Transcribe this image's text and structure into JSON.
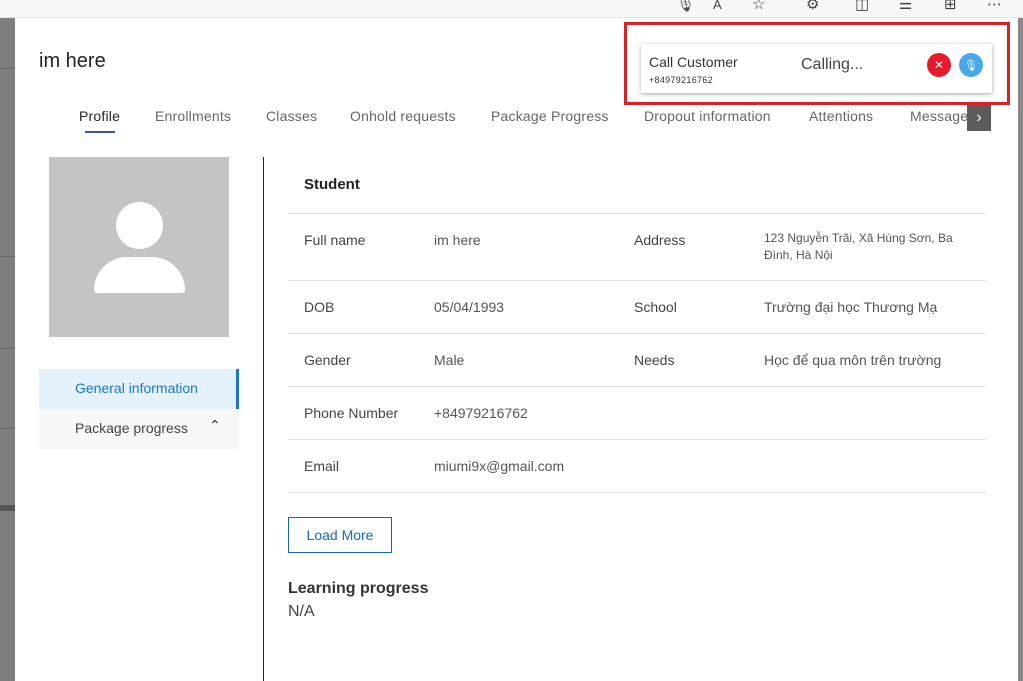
{
  "modal": {
    "title": "im here"
  },
  "tabs": [
    {
      "label": "Profile",
      "active": true
    },
    {
      "label": "Enrollments"
    },
    {
      "label": "Classes"
    },
    {
      "label": "Onhold requests"
    },
    {
      "label": "Package Progress"
    },
    {
      "label": "Dropout information"
    },
    {
      "label": "Attentions"
    },
    {
      "label": "Message"
    }
  ],
  "side_menu": [
    {
      "label": "General information",
      "active": true
    },
    {
      "label": "Package progress",
      "icon": "chevron-up-icon"
    }
  ],
  "student": {
    "section_title": "Student",
    "rows": [
      {
        "label": "Full name",
        "value": "im here",
        "label2": "Address",
        "value2": "123 Nguyễn Trãi, Xã Hùng Sơn, Ba Đình, Hà Nội"
      },
      {
        "label": "DOB",
        "value": "05/04/1993",
        "label2": "School",
        "value2": "Trường đại học Thương Mạ"
      },
      {
        "label": "Gender",
        "value": "Male",
        "label2": "Needs",
        "value2": "Học để qua môn trên trường"
      },
      {
        "label": "Phone Number",
        "value": "+84979216762"
      },
      {
        "label": "Email",
        "value": "miumi9x@gmail.com"
      }
    ],
    "load_more": "Load More"
  },
  "learning_progress": {
    "title": "Learning progress",
    "value": "N/A"
  },
  "call_widget": {
    "title": "Call Customer",
    "phone": "+84979216762",
    "status": "Calling...",
    "hangup_icon": "✕",
    "mic_icon": "🎙"
  },
  "browser_icons": [
    "mic-icon",
    "read-aloud-icon",
    "favorite-star-icon",
    "extensions-icon",
    "split-screen-icon",
    "favorites-list-icon",
    "collections-icon",
    "more-icon"
  ],
  "colors": {
    "accent": "#1976d2",
    "hangup": "#e8192c",
    "mic": "#49a9e8",
    "highlight_outline": "#e02020"
  }
}
